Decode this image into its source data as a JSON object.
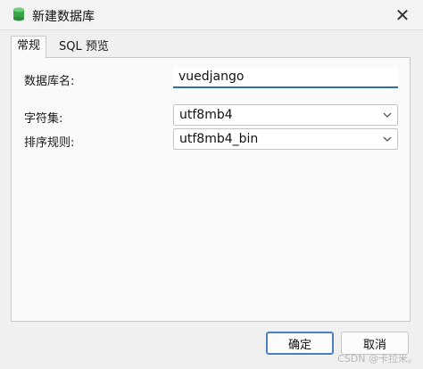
{
  "window": {
    "title": "新建数据库",
    "icon": "database-icon"
  },
  "tabs": [
    {
      "label": "常规",
      "active": true
    },
    {
      "label": "SQL 预览",
      "active": false
    }
  ],
  "form": {
    "db_name": {
      "label": "数据库名:",
      "value": "vuedjango"
    },
    "charset": {
      "label": "字符集:",
      "value": "utf8mb4"
    },
    "collation": {
      "label": "排序规则:",
      "value": "utf8mb4_bin"
    }
  },
  "buttons": {
    "ok": "确定",
    "cancel": "取消"
  },
  "watermark": "CSDN @卡拉米。",
  "colors": {
    "accent": "#2f6db3",
    "icon_green": "#3aa64c"
  }
}
